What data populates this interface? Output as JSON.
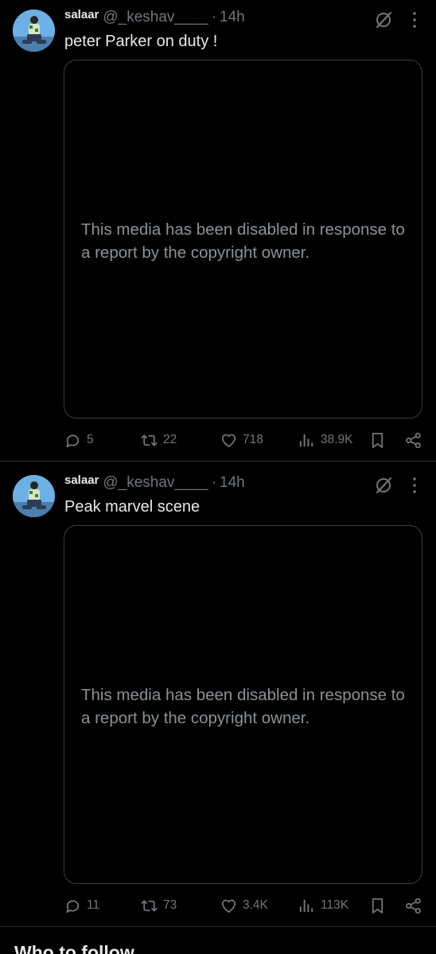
{
  "tweets": [
    {
      "name": "salaar",
      "handle": "@_keshav____",
      "separator": "·",
      "time": "14h",
      "text": "peter Parker on duty !",
      "media_message": "This media has been disabled in response to a report by the copyright owner.",
      "replies": "5",
      "retweets": "22",
      "likes": "718",
      "views": "38.9K"
    },
    {
      "name": "salaar",
      "handle": "@_keshav____",
      "separator": "·",
      "time": "14h",
      "text": "Peak marvel scene",
      "media_message": "This media has been disabled in response to a report by the copyright owner.",
      "replies": "11",
      "retweets": "73",
      "likes": "3.4K",
      "views": "113K"
    }
  ],
  "who_to_follow": "Who to follow",
  "icons": {
    "grok": "grok-icon",
    "more": "more-icon",
    "reply": "reply-icon",
    "retweet": "retweet-icon",
    "like": "heart-icon",
    "views": "views-icon",
    "bookmark": "bookmark-icon",
    "share": "share-icon"
  },
  "colors": {
    "background": "#000000",
    "text_primary": "#e7e9ea",
    "text_secondary": "#71767b",
    "border": "#2f3336"
  }
}
